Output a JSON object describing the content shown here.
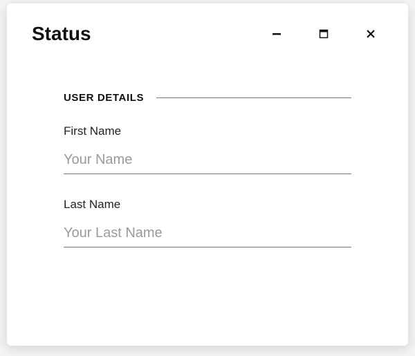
{
  "window": {
    "title": "Status"
  },
  "section": {
    "heading": "USER DETAILS"
  },
  "fields": {
    "first": {
      "label": "First Name",
      "placeholder": "Your Name",
      "value": ""
    },
    "last": {
      "label": "Last Name",
      "placeholder": "Your Last Name",
      "value": ""
    }
  }
}
